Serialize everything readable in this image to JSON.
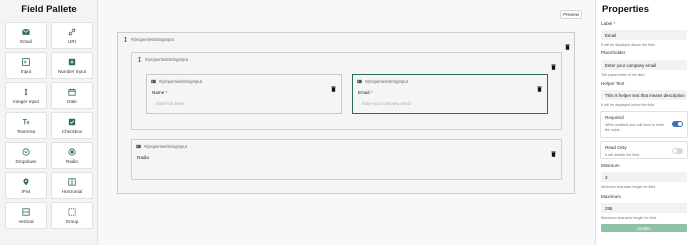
{
  "palette": {
    "title": "Field Pallete",
    "items": [
      {
        "label": "Email",
        "icon": "email-icon"
      },
      {
        "label": "URI",
        "icon": "link-icon"
      },
      {
        "label": "Input",
        "icon": "input-icon"
      },
      {
        "label": "Number Input",
        "icon": "number-icon"
      },
      {
        "label": "Integer Input",
        "icon": "integer-icon"
      },
      {
        "label": "Date",
        "icon": "calendar-icon"
      },
      {
        "label": "TextArea",
        "icon": "textarea-icon"
      },
      {
        "label": "Checkbox",
        "icon": "checkbox-icon"
      },
      {
        "label": "Dropdown",
        "icon": "dropdown-icon"
      },
      {
        "label": "Radio",
        "icon": "radio-icon"
      },
      {
        "label": "IPv4",
        "icon": "location-icon"
      },
      {
        "label": "Horizontal",
        "icon": "horizontal-icon"
      },
      {
        "label": "Vertical",
        "icon": "vertical-icon"
      },
      {
        "label": "Group",
        "icon": "group-icon"
      }
    ]
  },
  "canvas": {
    "preview_label": "Preview",
    "outer_path": "#/properties/stringInput",
    "inner_path": "#/properties/stringInput",
    "name_field": {
      "path": "#/properties/stringInput",
      "label": "Name",
      "required": "*",
      "placeholder": "Enter full name"
    },
    "email_field": {
      "path": "#/properties/stringInput",
      "label": "Email",
      "required": "*",
      "placeholder": "Enter your company email"
    },
    "radio_box": {
      "path": "#/properties/stringInput",
      "label": "Radio"
    }
  },
  "properties": {
    "title": "Properties",
    "label": {
      "caption": "Label",
      "required": "*",
      "value": "Email",
      "help": "It will be displayed above the field."
    },
    "placeholder": {
      "caption": "Placeholder",
      "value": "Enter your company email",
      "help": "The placeholder of the field."
    },
    "helper_text": {
      "caption": "Helper Text",
      "value": "This is helper text that means description",
      "help": "It will be displayed below the field."
    },
    "required": {
      "caption": "Required",
      "help": "When enabled user will have to enter the value.",
      "checked": true
    },
    "read_only": {
      "caption": "Read Only",
      "help": "It will disable the field.",
      "checked": false
    },
    "minimum": {
      "caption": "Minimum",
      "value": "3",
      "help": "Minimum character length for field."
    },
    "maximum": {
      "caption": "Maximum",
      "value": "255",
      "help": "Maximum character length for field."
    },
    "update_label": "Update"
  },
  "colors": {
    "accent": "#2e6e4a",
    "toggle_on": "#3d72b4",
    "toggle_off": "#d7d9d7",
    "button": "#8fc2a4"
  }
}
